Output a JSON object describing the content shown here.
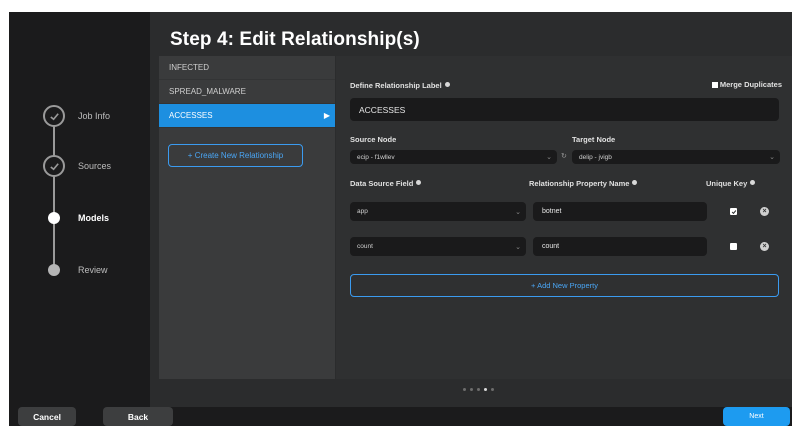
{
  "wizard": {
    "steps": [
      {
        "label": "Job Info",
        "state": "done"
      },
      {
        "label": "Sources",
        "state": "done"
      },
      {
        "label": "Models",
        "state": "current"
      },
      {
        "label": "Review",
        "state": "todo"
      }
    ]
  },
  "page_title": "Step 4: Edit Relationship(s)",
  "relationships": {
    "items": [
      "INFECTED",
      "SPREAD_MALWARE",
      "ACCESSES"
    ],
    "active_index": 2,
    "create_label": "+ Create New Relationship"
  },
  "form": {
    "label_heading": "Define Relationship Label",
    "merge_label": "Merge Duplicates",
    "label_value": "ACCESSES",
    "source_node_heading": "Source Node",
    "target_node_heading": "Target Node",
    "source_node_value": "ecip - f1wllev",
    "target_node_value": "delip - jvigb",
    "data_source_heading": "Data Source Field",
    "rel_prop_heading": "Relationship Property Name",
    "unique_key_heading": "Unique Key",
    "properties": [
      {
        "source_field": "app",
        "property_name": "botnet",
        "unique": true
      },
      {
        "source_field": "count",
        "property_name": "count",
        "unique": false
      }
    ],
    "add_property_label": "+ Add New Property"
  },
  "pager": {
    "dots": 5,
    "active": 3
  },
  "footer": {
    "cancel_label": "Cancel",
    "back_label": "Back",
    "next_label": "Next"
  },
  "colors": {
    "accent": "#1d8fe0",
    "accent_outline": "#3b9bf0",
    "background": "#1b1b1c",
    "panel": "#2b2c2d"
  }
}
